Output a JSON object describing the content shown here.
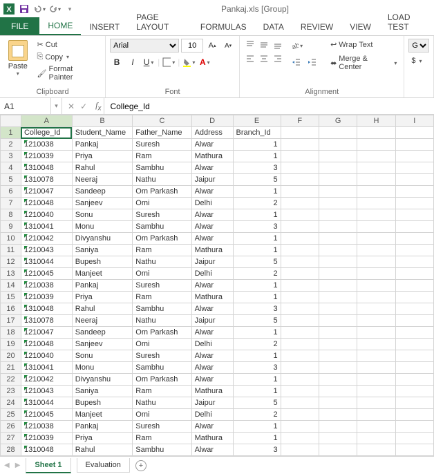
{
  "title": "Pankaj.xls  [Group]",
  "qat": {
    "excel": "X",
    "save": "save-icon",
    "undo": "undo-icon",
    "redo": "redo-icon"
  },
  "tabs": {
    "file": "FILE",
    "home": "HOME",
    "insert": "INSERT",
    "pagelayout": "PAGE LAYOUT",
    "formulas": "FORMULAS",
    "data": "DATA",
    "review": "REVIEW",
    "view": "VIEW",
    "loadtest": "LOAD TEST"
  },
  "ribbon": {
    "clipboard": {
      "paste": "Paste",
      "cut": "Cut",
      "copy": "Copy",
      "fmt": "Format Painter",
      "label": "Clipboard"
    },
    "font": {
      "name": "Arial",
      "size": "10",
      "label": "Font",
      "bold": "B",
      "italic": "I",
      "underline": "U"
    },
    "alignment": {
      "wrap": "Wrap Text",
      "merge": "Merge & Center",
      "label": "Alignment"
    },
    "number": {
      "general": "Gene",
      "currency": "$"
    }
  },
  "nameBox": "A1",
  "formula": "College_Id",
  "cols": [
    "A",
    "B",
    "C",
    "D",
    "E",
    "F",
    "G",
    "H",
    "I"
  ],
  "header": [
    "College_Id",
    "Student_Name",
    "Father_Name",
    "Address",
    "Branch_Id"
  ],
  "rows": [
    {
      "n": 1,
      "a": "College_Id",
      "b": "Student_Name",
      "c": "Father_Name",
      "d": "Address",
      "e": "Branch_Id",
      "hdr": true
    },
    {
      "n": 2,
      "a": "1210038",
      "b": "Pankaj",
      "c": "Suresh",
      "d": "Alwar",
      "e": "1"
    },
    {
      "n": 3,
      "a": "1210039",
      "b": "Priya",
      "c": "Ram",
      "d": "Mathura",
      "e": "1"
    },
    {
      "n": 4,
      "a": "1310048",
      "b": "Rahul",
      "c": "Sambhu",
      "d": "Alwar",
      "e": "3"
    },
    {
      "n": 5,
      "a": "1310078",
      "b": "Neeraj",
      "c": "Nathu",
      "d": "Jaipur",
      "e": "5"
    },
    {
      "n": 6,
      "a": "1210047",
      "b": "Sandeep",
      "c": "Om Parkash",
      "d": "Alwar",
      "e": "1"
    },
    {
      "n": 7,
      "a": "1210048",
      "b": "Sanjeev",
      "c": "Omi",
      "d": "Delhi",
      "e": "2"
    },
    {
      "n": 8,
      "a": "1210040",
      "b": "Sonu",
      "c": "Suresh",
      "d": "Alwar",
      "e": "1"
    },
    {
      "n": 9,
      "a": "1310041",
      "b": "Monu",
      "c": "Sambhu",
      "d": "Alwar",
      "e": "3"
    },
    {
      "n": 10,
      "a": "1210042",
      "b": "Divyanshu",
      "c": "Om Parkash",
      "d": "Alwar",
      "e": "1"
    },
    {
      "n": 11,
      "a": "1210043",
      "b": "Saniya",
      "c": "Ram",
      "d": "Mathura",
      "e": "1"
    },
    {
      "n": 12,
      "a": "1310044",
      "b": "Bupesh",
      "c": "Nathu",
      "d": "Jaipur",
      "e": "5"
    },
    {
      "n": 13,
      "a": "1210045",
      "b": "Manjeet",
      "c": "Omi",
      "d": "Delhi",
      "e": "2"
    },
    {
      "n": 14,
      "a": "1210038",
      "b": "Pankaj",
      "c": "Suresh",
      "d": "Alwar",
      "e": "1"
    },
    {
      "n": 15,
      "a": "1210039",
      "b": "Priya",
      "c": "Ram",
      "d": "Mathura",
      "e": "1"
    },
    {
      "n": 16,
      "a": "1310048",
      "b": "Rahul",
      "c": "Sambhu",
      "d": "Alwar",
      "e": "3"
    },
    {
      "n": 17,
      "a": "1310078",
      "b": "Neeraj",
      "c": "Nathu",
      "d": "Jaipur",
      "e": "5"
    },
    {
      "n": 18,
      "a": "1210047",
      "b": "Sandeep",
      "c": "Om Parkash",
      "d": "Alwar",
      "e": "1"
    },
    {
      "n": 19,
      "a": "1210048",
      "b": "Sanjeev",
      "c": "Omi",
      "d": "Delhi",
      "e": "2"
    },
    {
      "n": 20,
      "a": "1210040",
      "b": "Sonu",
      "c": "Suresh",
      "d": "Alwar",
      "e": "1"
    },
    {
      "n": 21,
      "a": "1310041",
      "b": "Monu",
      "c": "Sambhu",
      "d": "Alwar",
      "e": "3"
    },
    {
      "n": 22,
      "a": "1210042",
      "b": "Divyanshu",
      "c": "Om Parkash",
      "d": "Alwar",
      "e": "1"
    },
    {
      "n": 23,
      "a": "1210043",
      "b": "Saniya",
      "c": "Ram",
      "d": "Mathura",
      "e": "1"
    },
    {
      "n": 24,
      "a": "1310044",
      "b": "Bupesh",
      "c": "Nathu",
      "d": "Jaipur",
      "e": "5"
    },
    {
      "n": 25,
      "a": "1210045",
      "b": "Manjeet",
      "c": "Omi",
      "d": "Delhi",
      "e": "2"
    },
    {
      "n": 26,
      "a": "1210038",
      "b": "Pankaj",
      "c": "Suresh",
      "d": "Alwar",
      "e": "1"
    },
    {
      "n": 27,
      "a": "1210039",
      "b": "Priya",
      "c": "Ram",
      "d": "Mathura",
      "e": "1"
    },
    {
      "n": 28,
      "a": "1310048",
      "b": "Rahul",
      "c": "Sambhu",
      "d": "Alwar",
      "e": "3"
    }
  ],
  "sheetTabs": {
    "sheet1": "Sheet 1",
    "evaluation": "Evaluation"
  }
}
